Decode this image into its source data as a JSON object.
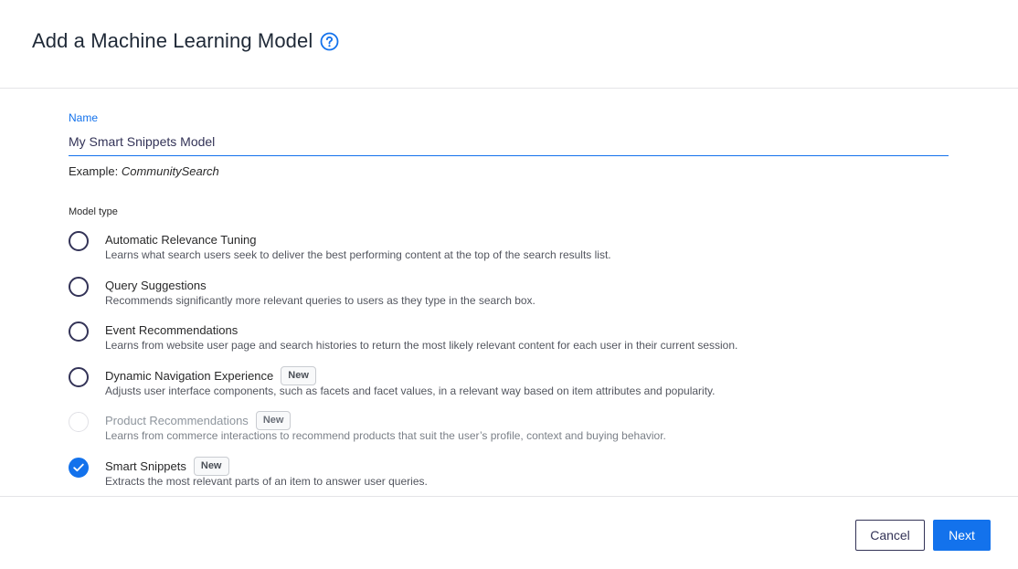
{
  "header": {
    "title": "Add a Machine Learning Model"
  },
  "form": {
    "name_label": "Name",
    "name_value": "My Smart Snippets Model",
    "example_prefix": "Example:",
    "example_value": "CommunitySearch",
    "model_type_label": "Model type"
  },
  "model_types": [
    {
      "title": "Automatic Relevance Tuning",
      "description": "Learns what search users seek to deliver the best performing content at the top of the search results list.",
      "badge": "",
      "selected": false,
      "disabled": false
    },
    {
      "title": "Query Suggestions",
      "description": "Recommends significantly more relevant queries to users as they type in the search box.",
      "badge": "",
      "selected": false,
      "disabled": false
    },
    {
      "title": "Event Recommendations",
      "description": "Learns from website user page and search histories to return the most likely relevant content for each user in their current session.",
      "badge": "",
      "selected": false,
      "disabled": false
    },
    {
      "title": "Dynamic Navigation Experience",
      "description": "Adjusts user interface components, such as facets and facet values, in a relevant way based on item attributes and popularity.",
      "badge": "New",
      "selected": false,
      "disabled": false
    },
    {
      "title": "Product Recommendations",
      "description": "Learns from commerce interactions to recommend products that suit the user’s profile, context and buying behavior.",
      "badge": "New",
      "selected": false,
      "disabled": true
    },
    {
      "title": "Smart Snippets",
      "description": "Extracts the most relevant parts of an item to answer user queries.",
      "badge": "New",
      "selected": true,
      "disabled": false
    }
  ],
  "footer": {
    "cancel_label": "Cancel",
    "next_label": "Next"
  },
  "colors": {
    "accent": "#1372ec",
    "dark": "#333357",
    "disabled": "#e1e1e6"
  },
  "icons": {
    "help": "question-circle-icon",
    "check": "check-icon"
  }
}
